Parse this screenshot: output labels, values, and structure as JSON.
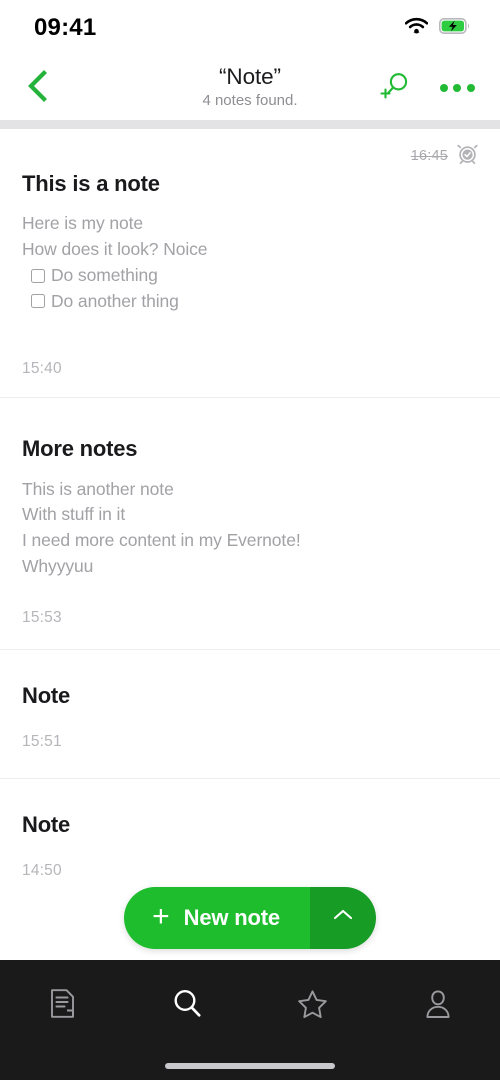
{
  "status_bar": {
    "time": "09:41",
    "wifi_icon": "wifi-icon",
    "battery_icon": "battery-charging-icon"
  },
  "header": {
    "back_icon": "chevron-left-icon",
    "title": "“Note”",
    "subtitle": "4 notes found.",
    "save_search_icon": "search-plus-icon",
    "overflow_icon": "more-horizontal-icon"
  },
  "colors": {
    "accent_green": "#1ebd2e",
    "accent_green_dark": "#179c25",
    "nav_green": "#21ba35",
    "tabbar_bg": "#1a1a1a",
    "muted_text": "#a2a2a6",
    "timestamp_text": "#b6b6ba"
  },
  "notes": [
    {
      "title": "This is a note",
      "reminder_time": "16:45",
      "reminder_icon": "alarm-done-icon",
      "lines": [
        {
          "type": "text",
          "text": "Here is my note"
        },
        {
          "type": "text",
          "text": "How does it look? Noice"
        },
        {
          "type": "todo",
          "text": "Do something",
          "checked": false
        },
        {
          "type": "todo",
          "text": "Do another thing",
          "checked": false
        }
      ],
      "time": "15:40"
    },
    {
      "title": "More notes",
      "lines": [
        {
          "type": "text",
          "text": "This is another note"
        },
        {
          "type": "text",
          "text": "With stuff in it"
        },
        {
          "type": "text",
          "text": "I need more content in my Evernote!"
        },
        {
          "type": "text",
          "text": "Whyyyuu"
        }
      ],
      "time": "15:53"
    },
    {
      "title": "Note",
      "lines": [],
      "time": "15:51"
    },
    {
      "title": "Note",
      "lines": [],
      "time": "14:50"
    }
  ],
  "new_note_button": {
    "plus": "+",
    "label": "New note",
    "caret_icon": "chevron-up-icon"
  },
  "tab_bar": {
    "items": [
      {
        "name": "notes",
        "icon": "note-document-icon",
        "active": false
      },
      {
        "name": "search",
        "icon": "search-icon",
        "active": true
      },
      {
        "name": "shortcuts",
        "icon": "star-icon",
        "active": false
      },
      {
        "name": "account",
        "icon": "person-icon",
        "active": false
      }
    ]
  }
}
